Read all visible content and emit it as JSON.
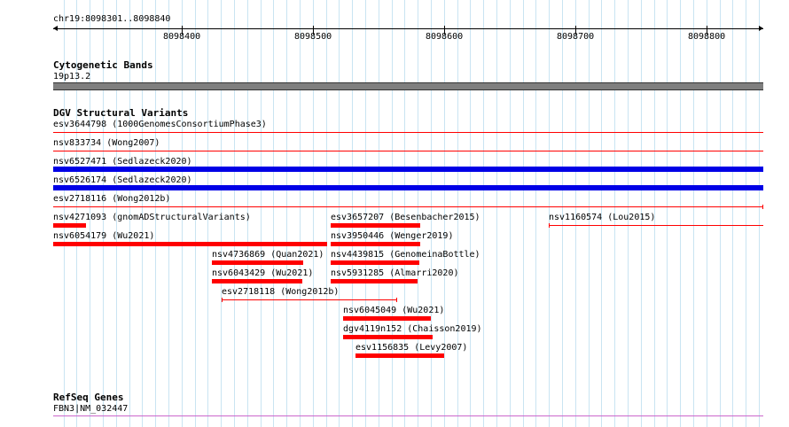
{
  "ruler": {
    "location": "chr19:8098301..8098840",
    "ticks": [
      "8098400",
      "8098500",
      "8098600",
      "8098700",
      "8098800"
    ]
  },
  "cytoband": {
    "title": "Cytogenetic Bands",
    "band": "19p13.2"
  },
  "dgv": {
    "title": "DGV Structural Variants",
    "items": [
      {
        "label": "esv3644798 (1000GenomesConsortiumPhase3)"
      },
      {
        "label": "nsv833734 (Wong2007)"
      },
      {
        "label": "nsv6527471 (Sedlazeck2020)"
      },
      {
        "label": "nsv6526174 (Sedlazeck2020)"
      },
      {
        "label": "esv2718116 (Wong2012b)"
      },
      {
        "label": "nsv4271093 (gnomADStructuralVariants)"
      },
      {
        "label": "esv3657207 (Besenbacher2015)"
      },
      {
        "label": "nsv1160574 (Lou2015)"
      },
      {
        "label": "nsv6054179 (Wu2021)"
      },
      {
        "label": "nsv3950446 (Wenger2019)"
      },
      {
        "label": "nsv4736869 (Quan2021)"
      },
      {
        "label": "nsv4439815 (GenomeinaBottle)"
      },
      {
        "label": "nsv6043429 (Wu2021)"
      },
      {
        "label": "nsv5931285 (Almarri2020)"
      },
      {
        "label": "esv2718118 (Wong2012b)"
      },
      {
        "label": "nsv6045049 (Wu2021)"
      },
      {
        "label": "dgv4119n152 (Chaisson2019)"
      },
      {
        "label": "esv1156835 (Levy2007)"
      }
    ]
  },
  "refseq": {
    "title": "RefSeq Genes",
    "gene": "FBN3|NM_032447"
  },
  "colors": {
    "variant_red": "#ff0000",
    "variant_blue": "#0000e6",
    "cytoband_gray": "#7f7f7f",
    "gene_purple": "#cc66cc",
    "grid_blue": "#c9e4f2"
  }
}
